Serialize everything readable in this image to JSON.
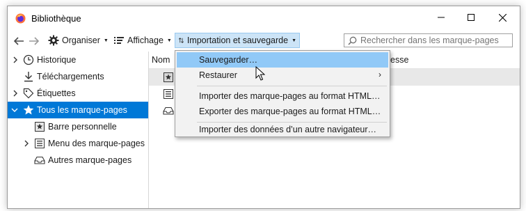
{
  "window": {
    "title": "Bibliothèque"
  },
  "toolbar": {
    "organise_label": "Organiser",
    "view_label": "Affichage",
    "import_backup_label": "Importation et sauvegarde",
    "search_placeholder": "Rechercher dans les marque-pages"
  },
  "sidebar": {
    "items": [
      {
        "label": "Historique",
        "icon": "clock-icon"
      },
      {
        "label": "Téléchargements",
        "icon": "download-icon"
      },
      {
        "label": "Étiquettes",
        "icon": "tag-icon"
      },
      {
        "label": "Tous les marque-pages",
        "icon": "star-icon",
        "selected": true
      },
      {
        "label": "Barre personnelle",
        "icon": "toolbar-star-icon"
      },
      {
        "label": "Menu des marque-pages",
        "icon": "menu-list-icon"
      },
      {
        "label": "Autres marque-pages",
        "icon": "tray-icon"
      }
    ]
  },
  "list": {
    "col_name_visible": "Nom",
    "col_address_visible": "esse"
  },
  "menu": {
    "items": [
      {
        "label": "Sauvegarder…",
        "hover": true
      },
      {
        "label": "Restaurer",
        "submenu": true
      },
      {
        "label": "Importer des marque-pages au format HTML…"
      },
      {
        "label": "Exporter des marque-pages au format HTML…"
      },
      {
        "label": "Importer des données d’un autre navigateur…"
      }
    ]
  },
  "colors": {
    "selection": "#0078d7",
    "menu_hover": "#91c9f7",
    "active_toolbar_button": "#cce4f7"
  }
}
